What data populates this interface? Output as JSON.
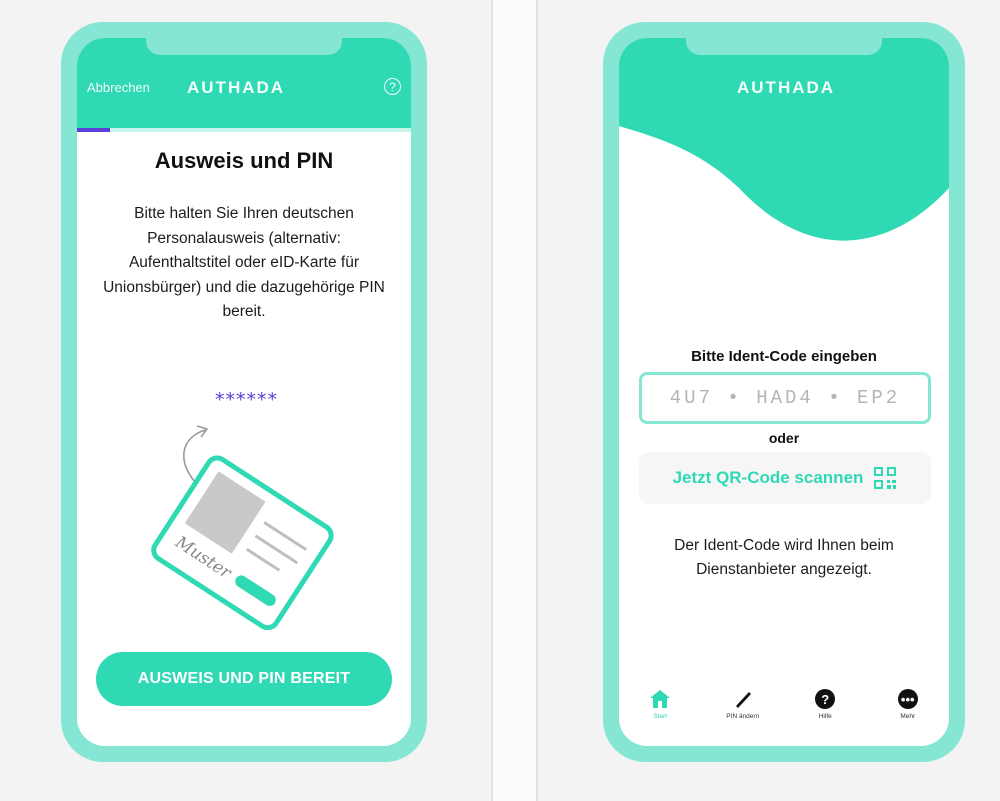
{
  "brand": {
    "name": "AUTHADA",
    "accent": "#2fd9b4",
    "frame": "#84e6d3",
    "progress": "#5b3fd6"
  },
  "screen1": {
    "cancel": "Abbrechen",
    "help_icon": "question-circle-icon",
    "progress_fraction": 0.1,
    "title": "Ausweis und PIN",
    "body": "Bitte halten Sie Ihren deutschen Personalausweis (alternativ: Aufenthaltstitel oder eID-Karte für Unionsbürger) und die dazugehörige PIN bereit.",
    "pin_mask": "******",
    "signature": "Muster",
    "button": "AUSWEIS UND PIN BEREIT"
  },
  "screen2": {
    "code_label": "Bitte Ident-Code eingeben",
    "code_placeholder": "4U7 • HAD4 • EP2",
    "or": "oder",
    "qr_button": "Jetzt QR-Code scannen",
    "hint": "Der Ident-Code wird Ihnen beim Dienstanbieter angezeigt.",
    "tabs": [
      {
        "label": "Start",
        "icon": "home-icon"
      },
      {
        "label": "PIN ändern",
        "icon": "pen-icon"
      },
      {
        "label": "Hilfe",
        "icon": "help-icon"
      },
      {
        "label": "Mehr",
        "icon": "more-icon"
      }
    ]
  }
}
